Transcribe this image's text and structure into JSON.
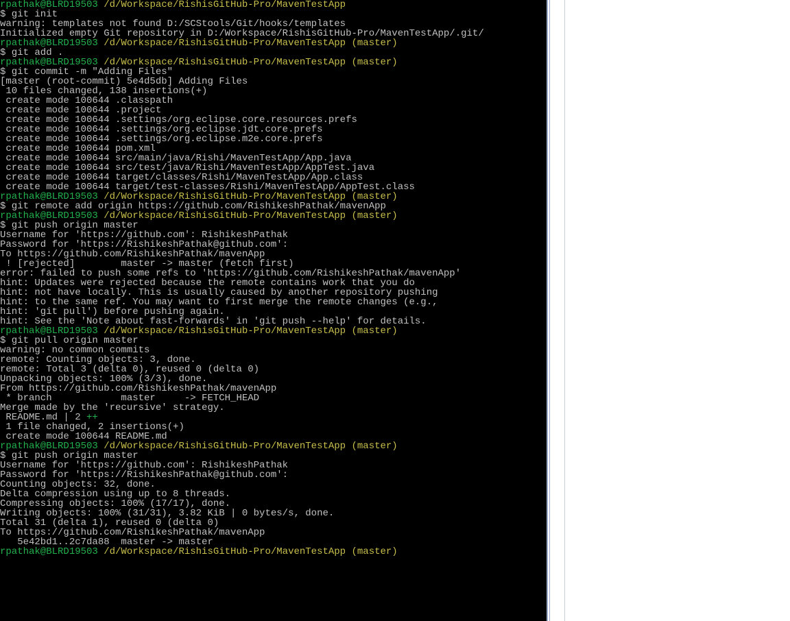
{
  "prompt_user": "rpathak@BLRD19503",
  "prompt_path_nobranch": " /d/Workspace/RishisGitHub-Pro/MavenTestApp",
  "prompt_path_master": " /d/Workspace/RishisGitHub-Pro/MavenTestApp (master)",
  "blocks": [
    {
      "type": "prompt_nobranch",
      "cmd": "$ git init",
      "out": [
        "warning: templates not found D:/SCStools/Git/hooks/templates",
        "Initialized empty Git repository in D:/Workspace/RishisGitHub-Pro/MavenTestApp/.git/"
      ]
    },
    {
      "type": "prompt_master",
      "cmd": "$ git add .",
      "out": []
    },
    {
      "type": "prompt_master",
      "cmd": "$ git commit -m \"Adding Files\"",
      "out": [
        "[master (root-commit) 5e4d5db] Adding Files",
        " 10 files changed, 138 insertions(+)",
        " create mode 100644 .classpath",
        " create mode 100644 .project",
        " create mode 100644 .settings/org.eclipse.core.resources.prefs",
        " create mode 100644 .settings/org.eclipse.jdt.core.prefs",
        " create mode 100644 .settings/org.eclipse.m2e.core.prefs",
        " create mode 100644 pom.xml",
        " create mode 100644 src/main/java/Rishi/MavenTestApp/App.java",
        " create mode 100644 src/test/java/Rishi/MavenTestApp/AppTest.java",
        " create mode 100644 target/classes/Rishi/MavenTestApp/App.class",
        " create mode 100644 target/test-classes/Rishi/MavenTestApp/AppTest.class"
      ]
    },
    {
      "type": "prompt_master",
      "cmd": "$ git remote add origin https://github.com/RishikeshPathak/mavenApp",
      "out": []
    },
    {
      "type": "prompt_master",
      "cmd": "$ git push origin master",
      "out": [
        "Username for 'https://github.com': RishikeshPathak",
        "Password for 'https://RishikeshPathak@github.com':",
        "To https://github.com/RishikeshPathak/mavenApp",
        " ! [rejected]        master -> master (fetch first)",
        "error: failed to push some refs to 'https://github.com/RishikeshPathak/mavenApp'",
        "hint: Updates were rejected because the remote contains work that you do",
        "hint: not have locally. This is usually caused by another repository pushing",
        "hint: to the same ref. You may want to first merge the remote changes (e.g.,",
        "hint: 'git pull') before pushing again.",
        "hint: See the 'Note about fast-forwards' in 'git push --help' for details."
      ]
    },
    {
      "type": "prompt_master",
      "cmd": "$ git pull origin master",
      "out": [
        "warning: no common commits",
        "remote: Counting objects: 3, done.",
        "remote: Total 3 (delta 0), reused 0 (delta 0)",
        "Unpacking objects: 100% (3/3), done.",
        "From https://github.com/RishikeshPathak/mavenApp",
        " * branch            master     -> FETCH_HEAD",
        "Merge made by the 'recursive' strategy."
      ],
      "diffstat": {
        "pre": " README.md | 2 ",
        "plus": "++"
      },
      "out2": [
        " 1 file changed, 2 insertions(+)",
        " create mode 100644 README.md"
      ]
    },
    {
      "type": "prompt_master",
      "cmd": "$ git push origin master",
      "out": [
        "Username for 'https://github.com': RishikeshPathak",
        "Password for 'https://RishikeshPathak@github.com':",
        "Counting objects: 32, done.",
        "Delta compression using up to 8 threads.",
        "Compressing objects: 100% (17/17), done.",
        "Writing objects: 100% (31/31), 3.82 KiB | 0 bytes/s, done.",
        "Total 31 (delta 1), reused 0 (delta 0)",
        "To https://github.com/RishikeshPathak/mavenApp",
        "   5e42bd1..2c7da88  master -> master"
      ]
    },
    {
      "type": "prompt_master_trailing"
    }
  ]
}
